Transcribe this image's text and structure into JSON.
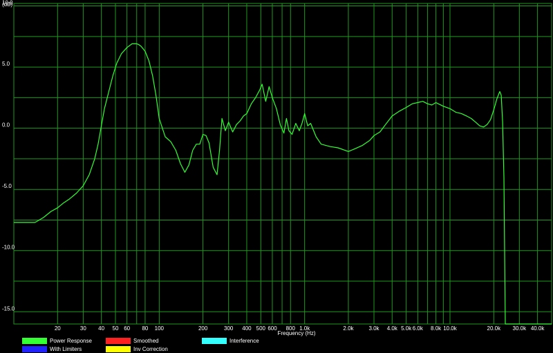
{
  "chart_data": {
    "type": "line",
    "title": "",
    "xlabel": "Frequency (Hz)",
    "ylabel": "(dB)",
    "xscale": "log",
    "xlim": [
      10,
      50000
    ],
    "ylim": [
      -16,
      10.2
    ],
    "grid": true,
    "x_ticks": [
      {
        "v": 20,
        "label": "20"
      },
      {
        "v": 30,
        "label": "30"
      },
      {
        "v": 40,
        "label": "40"
      },
      {
        "v": 50,
        "label": "50"
      },
      {
        "v": 60,
        "label": "60"
      },
      {
        "v": 80,
        "label": "80"
      },
      {
        "v": 100,
        "label": "100"
      },
      {
        "v": 200,
        "label": "200"
      },
      {
        "v": 300,
        "label": "300"
      },
      {
        "v": 400,
        "label": "400"
      },
      {
        "v": 500,
        "label": "500"
      },
      {
        "v": 600,
        "label": "600"
      },
      {
        "v": 800,
        "label": "800"
      },
      {
        "v": 1000,
        "label": "1.0k"
      },
      {
        "v": 2000,
        "label": "2.0k"
      },
      {
        "v": 3000,
        "label": "3.0k"
      },
      {
        "v": 4000,
        "label": "4.0k"
      },
      {
        "v": 5000,
        "label": "5.0k"
      },
      {
        "v": 6000,
        "label": "6.0k"
      },
      {
        "v": 8000,
        "label": "8.0k"
      },
      {
        "v": 10000,
        "label": "10.0k"
      },
      {
        "v": 20000,
        "label": "20.0k"
      },
      {
        "v": 30000,
        "label": "30.0k"
      },
      {
        "v": 40000,
        "label": "40.0k"
      }
    ],
    "x_minor_grid": [
      70,
      700,
      7000,
      9000
    ],
    "y_ticks": [
      {
        "v": 10,
        "label": "10.0"
      },
      {
        "v": 5,
        "label": "5.0"
      },
      {
        "v": 0,
        "label": "0.0"
      },
      {
        "v": -5,
        "label": "-5.0"
      },
      {
        "v": -10,
        "label": "-10.0"
      },
      {
        "v": -15,
        "label": "-15.0"
      }
    ],
    "y_minor_grid": [
      7.5,
      2.5,
      -2.5,
      -7.5,
      -12.5
    ],
    "series": [
      {
        "name": "Power Response",
        "color": "#33ff33",
        "x": [
          10,
          14,
          16,
          18,
          20,
          22,
          24,
          27,
          30,
          33,
          36,
          38,
          40,
          42,
          45,
          48,
          51,
          55,
          60,
          65,
          70,
          72,
          75,
          80,
          85,
          90,
          95,
          100,
          110,
          120,
          130,
          140,
          150,
          160,
          170,
          180,
          190,
          200,
          210,
          220,
          235,
          250,
          260,
          270,
          285,
          300,
          320,
          340,
          360,
          380,
          400,
          430,
          460,
          490,
          510,
          540,
          570,
          600,
          640,
          680,
          720,
          750,
          780,
          820,
          870,
          920,
          960,
          1000,
          1050,
          1100,
          1200,
          1300,
          1500,
          1700,
          2000,
          2200,
          2500,
          2800,
          3000,
          3300,
          3600,
          4000,
          4500,
          5000,
          5500,
          6000,
          6500,
          7000,
          7500,
          8000,
          9000,
          10000,
          11000,
          12000,
          13000,
          14000,
          15000,
          16000,
          17000,
          18000,
          19000,
          20000,
          21000,
          22000,
          22500,
          23000,
          23500,
          24000,
          50000
        ],
        "values": [
          -7.7,
          -7.7,
          -7.3,
          -6.8,
          -6.5,
          -6.1,
          -5.8,
          -5.3,
          -4.7,
          -3.8,
          -2.5,
          -1.3,
          0.2,
          1.6,
          3.0,
          4.3,
          5.3,
          6.1,
          6.6,
          6.9,
          6.9,
          6.85,
          6.7,
          6.3,
          5.5,
          4.3,
          2.7,
          0.8,
          -0.7,
          -1.1,
          -1.8,
          -2.9,
          -3.6,
          -3.0,
          -1.8,
          -1.3,
          -1.3,
          -0.5,
          -0.6,
          -1.2,
          -3.2,
          -3.8,
          -1.8,
          0.8,
          -0.2,
          0.5,
          -0.3,
          0.3,
          0.6,
          1.0,
          1.2,
          2.0,
          2.5,
          3.1,
          3.6,
          2.2,
          3.4,
          2.5,
          1.6,
          0.3,
          -0.4,
          0.8,
          -0.2,
          -0.5,
          0.4,
          -0.2,
          0.4,
          1.2,
          0.2,
          0.4,
          -0.7,
          -1.3,
          -1.5,
          -1.6,
          -1.9,
          -1.7,
          -1.4,
          -1.0,
          -0.6,
          -0.3,
          0.3,
          1.0,
          1.4,
          1.7,
          2.0,
          2.1,
          2.2,
          2.0,
          1.9,
          2.1,
          1.8,
          1.6,
          1.3,
          1.2,
          1.0,
          0.8,
          0.5,
          0.2,
          0.1,
          0.3,
          0.7,
          1.5,
          2.4,
          3.0,
          2.7,
          0.5,
          -4.0,
          -16.0,
          -16.0
        ]
      },
      {
        "name": "Smoothed",
        "color": "#ff2020",
        "x": [],
        "values": []
      },
      {
        "name": "Interference",
        "color": "#33ffff",
        "x": [],
        "values": []
      },
      {
        "name": "With Limiters",
        "color": "#2020ff",
        "x": [],
        "values": []
      },
      {
        "name": "Inv Correction",
        "color": "#ffff00",
        "x": [],
        "values": []
      }
    ]
  }
}
